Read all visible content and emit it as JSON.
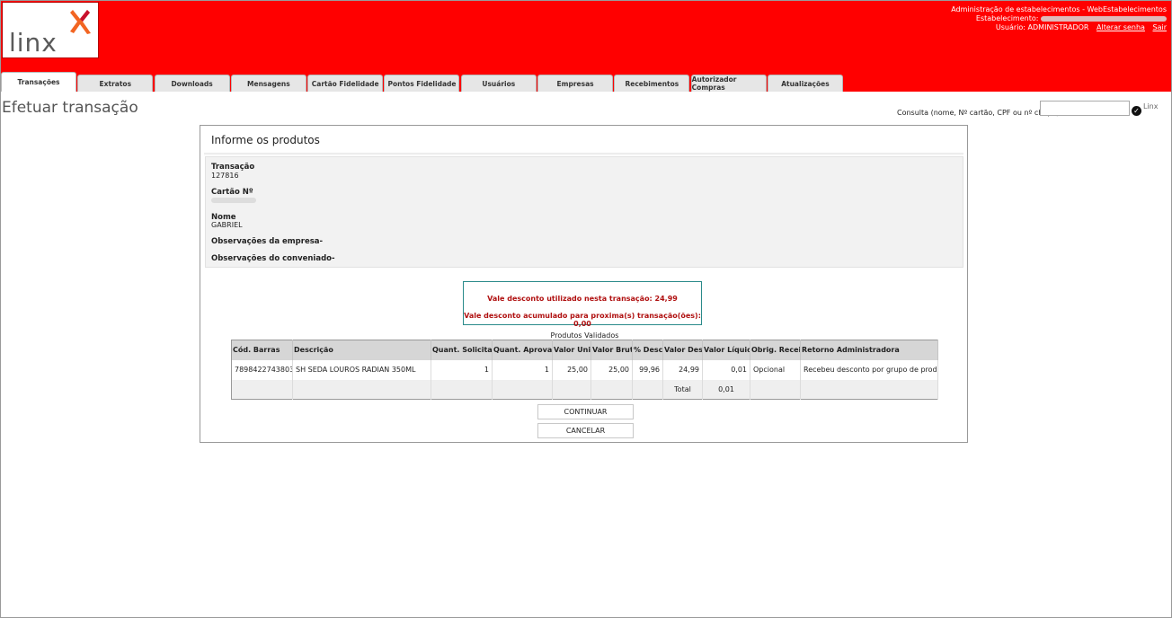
{
  "header": {
    "logo_text": "linx",
    "admin_line": "Administração de estabelecimentos - WebEstabelecimentos",
    "estab_label": "Estabelecimento:",
    "user_label": "Usuário: ADMINISTRADOR",
    "change_password": "Alterar senha",
    "logout": "Sair",
    "colors": {
      "brand_red": "#ff0000",
      "logo_orange": "#f26522"
    }
  },
  "tabs": [
    {
      "label": "Transações",
      "active": true
    },
    {
      "label": "Extratos"
    },
    {
      "label": "Downloads"
    },
    {
      "label": "Mensagens"
    },
    {
      "label": "Cartão Fidelidade"
    },
    {
      "label": "Pontos Fidelidade"
    },
    {
      "label": "Usuários"
    },
    {
      "label": "Empresas"
    },
    {
      "label": "Recebimentos"
    },
    {
      "label": "Autorizador Compras"
    },
    {
      "label": "Atualizações"
    }
  ],
  "page": {
    "title": "Efetuar transação",
    "search_label": "Consulta (nome, Nº cartão, CPF ou nº chapa)",
    "search_value": "",
    "mini_logo": "Linx"
  },
  "panel": {
    "title": "Informe os produtos",
    "transacao_label": "Transação",
    "transacao_value": "127816",
    "cartao_label": "Cartão Nº",
    "nome_label": "Nome",
    "nome_value": "GABRIEL",
    "obs_empresa": "Observações da empresa-",
    "obs_conveniado": "Observações do conveniado-",
    "vale_utilizado": "Vale desconto utilizado nesta transação: 24,99",
    "vale_acumulado": "Vale desconto acumulado para proxima(s) transação(ões): 0,00",
    "grid_caption": "Produtos Validados",
    "columns": [
      "Cód. Barras",
      "Descrição",
      "Quant. Solicitada",
      "Quant. Aprovada",
      "Valor Unit.",
      "Valor Bruto",
      "% Desc.",
      "Valor Desc.",
      "Valor Líquido",
      "Obrig. Receita",
      "Retorno Administradora"
    ],
    "rows": [
      [
        "7898422743803",
        "SH SEDA LOUROS RADIAN 350ML",
        "1",
        "1",
        "25,00",
        "25,00",
        "99,96",
        "24,99",
        "0,01",
        "Opcional",
        "Recebeu desconto por grupo de produto"
      ]
    ],
    "total_label": "Total",
    "total_value": "0,01",
    "continue_button": "CONTINUAR",
    "cancel_button": "CANCELAR"
  }
}
